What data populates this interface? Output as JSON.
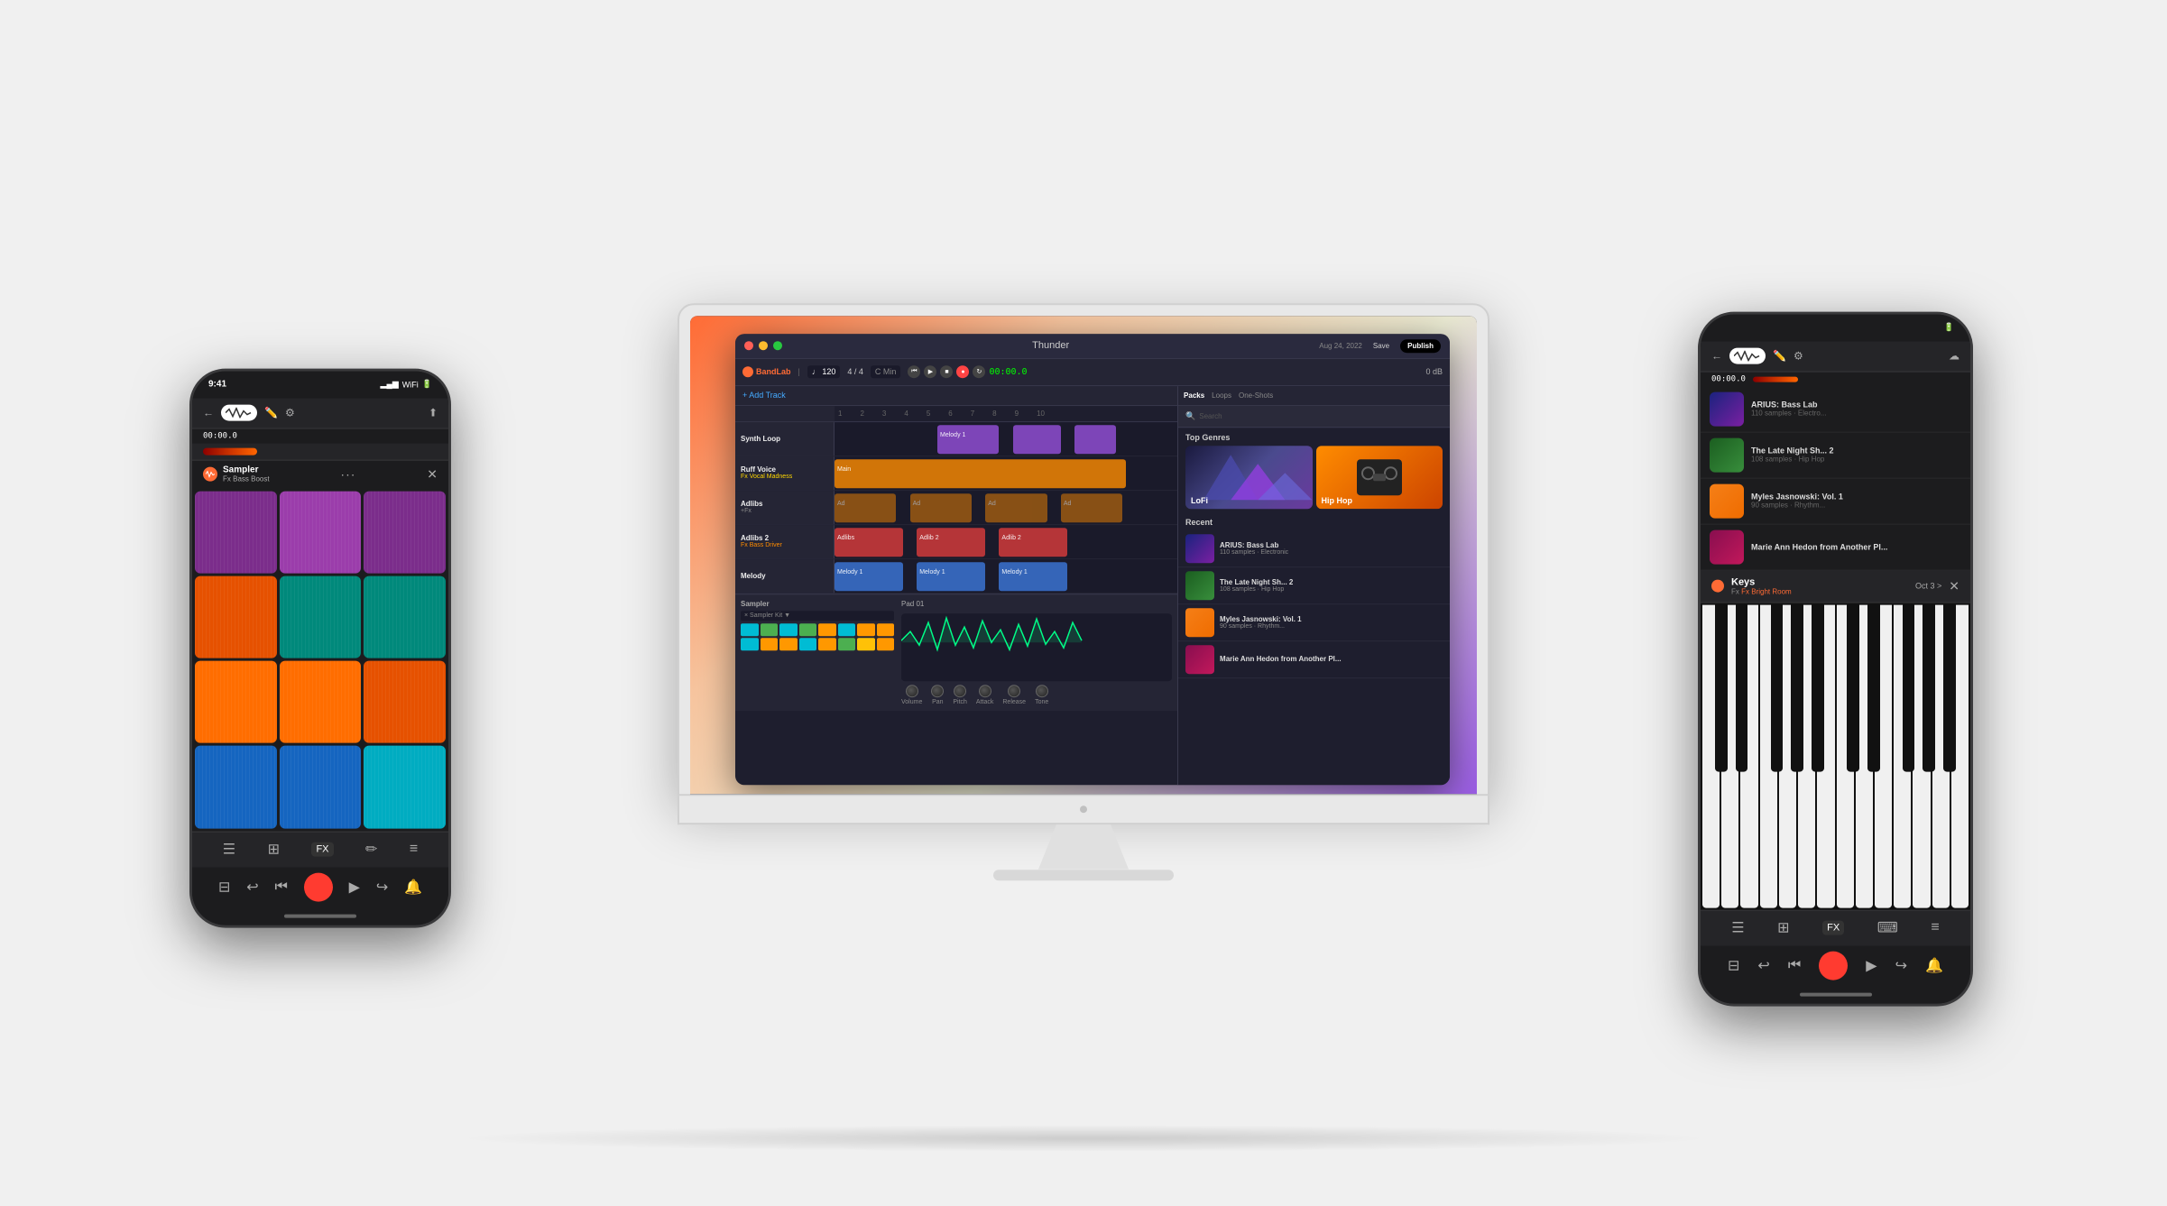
{
  "page": {
    "bg_color": "#f5f5f7"
  },
  "imac": {
    "daw": {
      "title": "Thunder",
      "date": "Aug 24, 2022",
      "save_label": "Save",
      "publish_label": "Publish",
      "bpm": "120",
      "time_sig": "4 / 4",
      "key": "C Min",
      "timer": "00:00.0",
      "volume": "0 dB",
      "add_track": "+ Add Track",
      "tracks": [
        {
          "name": "Synth Loop",
          "fx": "",
          "color": "purple"
        },
        {
          "name": "Ruff Voice",
          "fx": "Fx Vocal Madness",
          "fx_color": "yellow",
          "color": "orange"
        },
        {
          "name": "Adlibs",
          "fx": "+Fx",
          "fx_color": "default",
          "color": "orange"
        },
        {
          "name": "Adlibs 2",
          "fx": "Fx Bass Driver",
          "fx_color": "orange",
          "color": "red"
        },
        {
          "name": "Melody",
          "fx": "",
          "color": "blue"
        }
      ],
      "sounds_panel": {
        "tabs": [
          "Packs",
          "Loops",
          "One-Shots"
        ],
        "search_placeholder": "Search",
        "top_genres_title": "Top Genres",
        "genres": [
          {
            "name": "LoFi"
          },
          {
            "name": "Hip Hop"
          }
        ],
        "recent_title": "Recent",
        "recent_items": [
          {
            "name": "ARIUS: Bass Lab",
            "sub": "110 samples · Electronic"
          },
          {
            "name": "The Late Night Sh... 2",
            "sub": "108 samples · Hip Hop"
          },
          {
            "name": "Myles Jasnowski: Vol. 1",
            "sub": "90 samples · Rhythm..."
          },
          {
            "name": "Marie Ann Hedon from Another Pl...",
            "sub": ""
          }
        ]
      },
      "sampler": {
        "title": "Sampler",
        "pad_title": "Pad 01"
      }
    }
  },
  "phone_left": {
    "status_time": "9:41",
    "timer": "00:00.0",
    "sampler_name": "Sampler",
    "sampler_fx": "Fx Bass Boost",
    "bottom_icons": [
      "list",
      "grid",
      "fx",
      "pencil",
      "menu"
    ]
  },
  "phone_right": {
    "timer": "00:00.0",
    "keys_name": "Keys",
    "keys_fx": "Fx Bright Room",
    "oct_label": "Oct 3 >",
    "close_label": "✕",
    "sounds": [
      {
        "name": "ARIUS: Bass Lab",
        "sub": "110 samples · Electro..."
      },
      {
        "name": "The Late Night Sh... 2",
        "sub": "108 samples · Hip Hop"
      },
      {
        "name": "Myles Jasnowski: Vol. 1",
        "sub": "90 samples · Rhythm..."
      },
      {
        "name": "Marie Ann Hedon from Another Pl...",
        "sub": ""
      }
    ]
  }
}
